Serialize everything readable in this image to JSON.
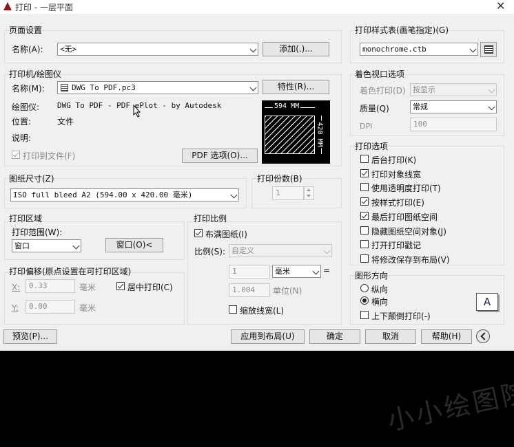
{
  "window": {
    "title": "打印 - 一层平面",
    "close": "✕"
  },
  "page_setup": {
    "title": "页面设置",
    "name_label": "名称(A):",
    "name_value": "<无>",
    "add_button": "添加(.)..."
  },
  "printer": {
    "title": "打印机/绘图仪",
    "name_label": "名称(M):",
    "name_value": "DWG To PDF.pc3",
    "properties_button": "特性(R)...",
    "plotter_label": "绘图仪:",
    "plotter_value": "DWG To PDF - PDF ePlot - by Autodesk",
    "location_label": "位置:",
    "location_value": "文件",
    "description_label": "说明:",
    "print_to_file_label": "打印到文件(F)",
    "pdf_options_button": "PDF 选项(O)...",
    "preview_width": "594 MM",
    "preview_height": "420 MM"
  },
  "paper_size": {
    "title": "图纸尺寸(Z)",
    "value": "ISO full bleed A2 (594.00 x 420.00 毫米)"
  },
  "copies": {
    "title": "打印份数(B)",
    "value": "1"
  },
  "plot_area": {
    "title": "打印区域",
    "range_label": "打印范围(W):",
    "range_value": "窗口",
    "window_button": "窗口(O)<"
  },
  "plot_offset": {
    "title": "打印偏移(原点设置在可打印区域)",
    "x_label": "X:",
    "x_value": "0.33",
    "x_unit": "毫米",
    "y_label": "Y:",
    "y_value": "0.00",
    "y_unit": "毫米",
    "center_label": "居中打印(C)"
  },
  "plot_scale": {
    "title": "打印比例",
    "fit_label": "布满图纸(I)",
    "scale_label": "比例(S):",
    "scale_value": "自定义",
    "value1": "1",
    "unit_value": "毫米",
    "equals": "=",
    "value2": "1.004",
    "unit_label": "单位(N)",
    "lineweights_label": "缩放线宽(L)"
  },
  "style_table": {
    "title": "打印样式表(画笔指定)(G)",
    "value": "monochrome.ctb"
  },
  "shaded": {
    "title": "着色视口选项",
    "shade_label": "着色打印(D)",
    "shade_value": "按显示",
    "quality_label": "质量(Q)",
    "quality_value": "常规",
    "dpi_label": "DPI",
    "dpi_value": "100"
  },
  "options": {
    "title": "打印选项",
    "items": [
      {
        "label": "后台打印(K)",
        "checked": false
      },
      {
        "label": "打印对象线宽",
        "checked": true
      },
      {
        "label": "使用透明度打印(T)",
        "checked": false
      },
      {
        "label": "按样式打印(E)",
        "checked": true
      },
      {
        "label": "最后打印图纸空间",
        "checked": true
      },
      {
        "label": "隐藏图纸空间对象(J)",
        "checked": false
      },
      {
        "label": "打开打印戳记",
        "checked": false
      },
      {
        "label": "将修改保存到布局(V)",
        "checked": false
      }
    ]
  },
  "orientation": {
    "title": "图形方向",
    "portrait_label": "纵向",
    "landscape_label": "横向",
    "upside_down_label": "上下颠倒打印(-)",
    "icon_letter": "A"
  },
  "footer": {
    "preview_button": "预览(P)...",
    "apply_button": "应用到布局(U)",
    "ok_button": "确定",
    "cancel_button": "取消",
    "help_button": "帮助(H)"
  },
  "watermark": "小小绘图院"
}
